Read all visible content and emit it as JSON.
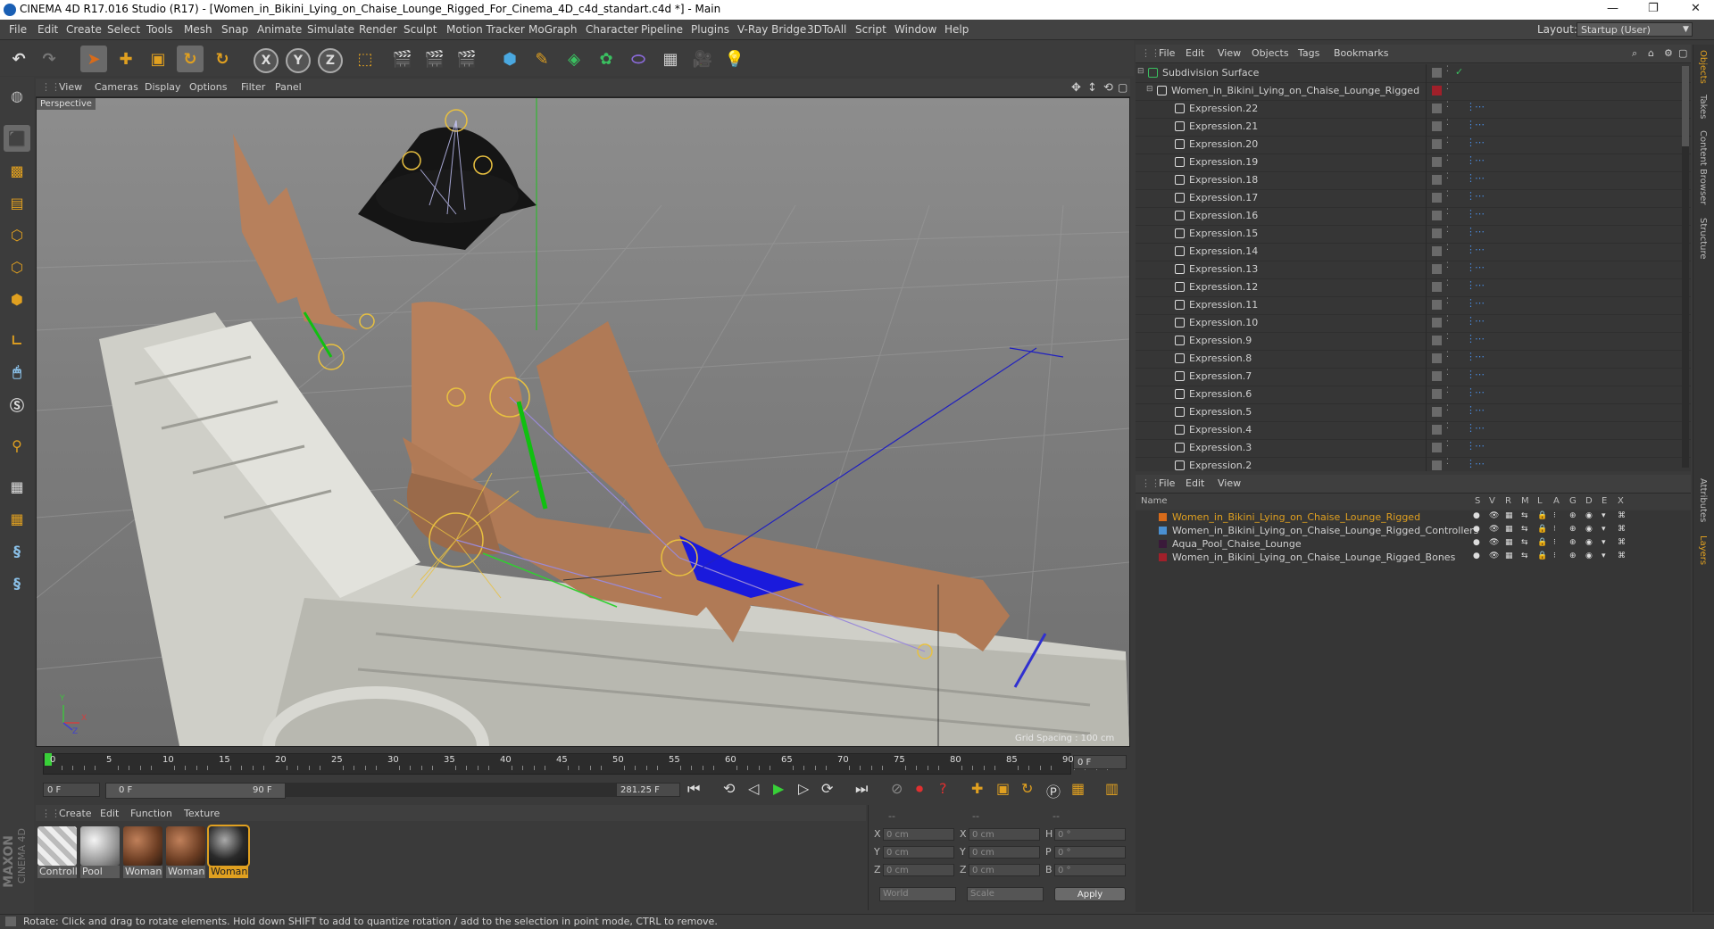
{
  "window": {
    "title": "CINEMA 4D R17.016 Studio (R17) - [Women_in_Bikini_Lying_on_Chaise_Lounge_Rigged_For_Cinema_4D_c4d_standart.c4d *] - Main",
    "minimize": "—",
    "maximize": "❐",
    "close": "✕"
  },
  "menubar": {
    "items": [
      "File",
      "Edit",
      "Create",
      "Select",
      "Tools",
      "Mesh",
      "Snap",
      "Animate",
      "Simulate",
      "Render",
      "Sculpt",
      "Motion Tracker",
      "MoGraph",
      "Character",
      "Pipeline",
      "Plugins",
      "V-Ray Bridge",
      "3DToAll",
      "Script",
      "Window",
      "Help"
    ],
    "layout_label": "Layout:",
    "layout_value": "Startup (User)"
  },
  "toolbar": {
    "axis_x": "X",
    "axis_y": "Y",
    "axis_z": "Z"
  },
  "viewport": {
    "menu": [
      "View",
      "Cameras",
      "Display",
      "Options",
      "Filter",
      "Panel"
    ],
    "camera_label": "Perspective",
    "grid_spacing": "Grid Spacing : 100 cm",
    "axis_x": "X",
    "axis_y": "Y",
    "axis_z": "Z"
  },
  "timeline": {
    "ticks": [
      "0",
      "5",
      "10",
      "15",
      "20",
      "25",
      "30",
      "35",
      "40",
      "45",
      "50",
      "55",
      "60",
      "65",
      "70",
      "75",
      "80",
      "85",
      "90"
    ],
    "current_frame": "0 F",
    "start_field": "0 F",
    "range_start": "0 F",
    "range_end": "90 F",
    "end_field": "281.25 F"
  },
  "materials": {
    "menu": [
      "Create",
      "Edit",
      "Function",
      "Texture"
    ],
    "items": [
      {
        "label": "Controll",
        "color": "#e6e6e6",
        "selected": false
      },
      {
        "label": "Pool",
        "color": "#c8c8c8",
        "selected": false
      },
      {
        "label": "Woman",
        "color": "#7a4a2e",
        "selected": false
      },
      {
        "label": "Woman",
        "color": "#7a4a2e",
        "selected": false
      },
      {
        "label": "Woman",
        "color": "#2a2a2a",
        "selected": true
      }
    ],
    "logo_line1": "MAXON",
    "logo_line2": "CINEMA 4D"
  },
  "coords": {
    "headers": [
      "--",
      "--",
      "--"
    ],
    "rows": [
      {
        "a": "X",
        "av": "0 cm",
        "b": "X",
        "bv": "0 cm",
        "c": "H",
        "cv": "0 °"
      },
      {
        "a": "Y",
        "av": "0 cm",
        "b": "Y",
        "bv": "0 cm",
        "c": "P",
        "cv": "0 °"
      },
      {
        "a": "Z",
        "av": "0 cm",
        "b": "Z",
        "bv": "0 cm",
        "c": "B",
        "cv": "0 °"
      }
    ],
    "world": "World",
    "scale": "Scale",
    "apply": "Apply"
  },
  "status": "Rotate: Click and drag to rotate elements. Hold down SHIFT to add to quantize rotation / add to the selection in point mode, CTRL to remove.",
  "object_manager": {
    "menu": [
      "File",
      "Edit",
      "View",
      "Objects",
      "Tags",
      "Bookmarks"
    ],
    "rows": [
      "Subdivision Surface",
      "Women_in_Bikini_Lying_on_Chaise_Lounge_Rigged",
      "Expression.22",
      "Expression.21",
      "Expression.20",
      "Expression.19",
      "Expression.18",
      "Expression.17",
      "Expression.16",
      "Expression.15",
      "Expression.14",
      "Expression.13",
      "Expression.12",
      "Expression.11",
      "Expression.10",
      "Expression.9",
      "Expression.8",
      "Expression.7",
      "Expression.6",
      "Expression.5",
      "Expression.4",
      "Expression.3",
      "Expression.2"
    ]
  },
  "layer_manager": {
    "menu": [
      "File",
      "Edit",
      "View"
    ],
    "name_col": "Name",
    "flags": [
      "S",
      "V",
      "R",
      "M",
      "L",
      "A",
      "G",
      "D",
      "E",
      "X"
    ],
    "rows": [
      {
        "name": "Women_in_Bikini_Lying_on_Chaise_Lounge_Rigged",
        "color": "#d86b1a",
        "highlight": true
      },
      {
        "name": "Women_in_Bikini_Lying_on_Chaise_Lounge_Rigged_Controllers",
        "color": "#4a8fd0",
        "highlight": false
      },
      {
        "name": "Aqua_Pool_Chaise_Lounge",
        "color": "#3a1a3a",
        "highlight": false
      },
      {
        "name": "Women_in_Bikini_Lying_on_Chaise_Lounge_Rigged_Bones",
        "color": "#a0202a",
        "highlight": false
      }
    ]
  },
  "right_tabs": [
    "Objects",
    "Takes",
    "Content Browser",
    "Structure",
    "Attributes",
    "Layers"
  ]
}
